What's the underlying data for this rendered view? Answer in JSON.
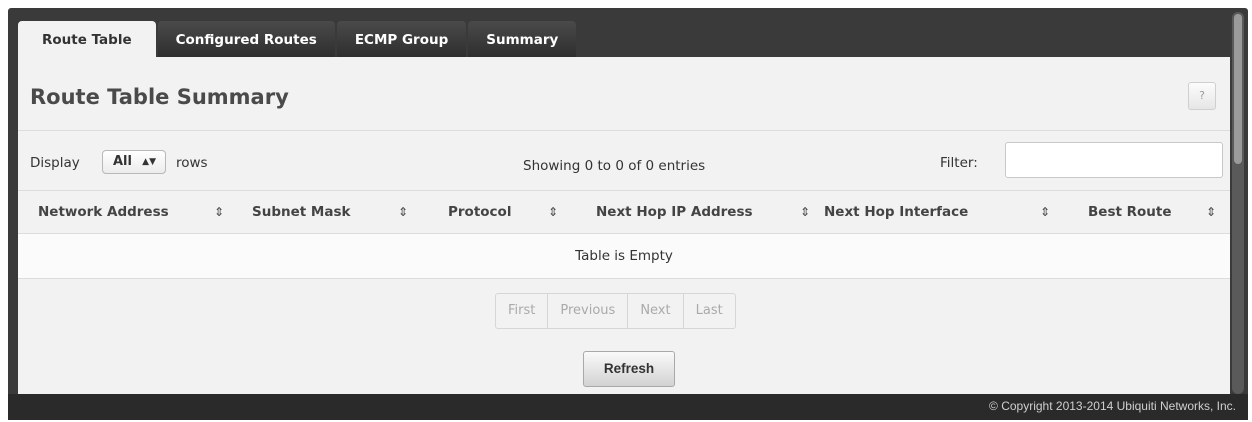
{
  "tabs": [
    {
      "label": "Route Table",
      "active": true
    },
    {
      "label": "Configured Routes",
      "active": false
    },
    {
      "label": "ECMP Group",
      "active": false
    },
    {
      "label": "Summary",
      "active": false
    }
  ],
  "page": {
    "title": "Route Table Summary",
    "help_label": "?"
  },
  "controls": {
    "display_label": "Display",
    "rows_selected": "All",
    "rows_label": "rows",
    "entries_info": "Showing 0 to 0 of 0 entries",
    "filter_label": "Filter:",
    "filter_value": ""
  },
  "table": {
    "columns": [
      {
        "label": "Network Address",
        "icon": "sort-icon"
      },
      {
        "label": "Subnet Mask",
        "icon": "sort-icon"
      },
      {
        "label": "Protocol",
        "icon": "sort-icon"
      },
      {
        "label": "Next Hop IP Address",
        "icon": "sort-icon"
      },
      {
        "label": "Next Hop Interface",
        "icon": "sort-icon"
      },
      {
        "label": "Best Route",
        "icon": "sort-icon"
      }
    ],
    "empty_message": "Table is Empty"
  },
  "pagination": {
    "first": "First",
    "previous": "Previous",
    "next": "Next",
    "last": "Last"
  },
  "actions": {
    "refresh": "Refresh"
  },
  "footer": {
    "copyright": "© Copyright 2013-2014 Ubiquiti Networks, Inc."
  },
  "colors": {
    "frame": "#3a3a3a",
    "panel": "#f2f2f2",
    "tab_inactive": "#2e2e2e",
    "tab_active": "#f2f2f2"
  }
}
